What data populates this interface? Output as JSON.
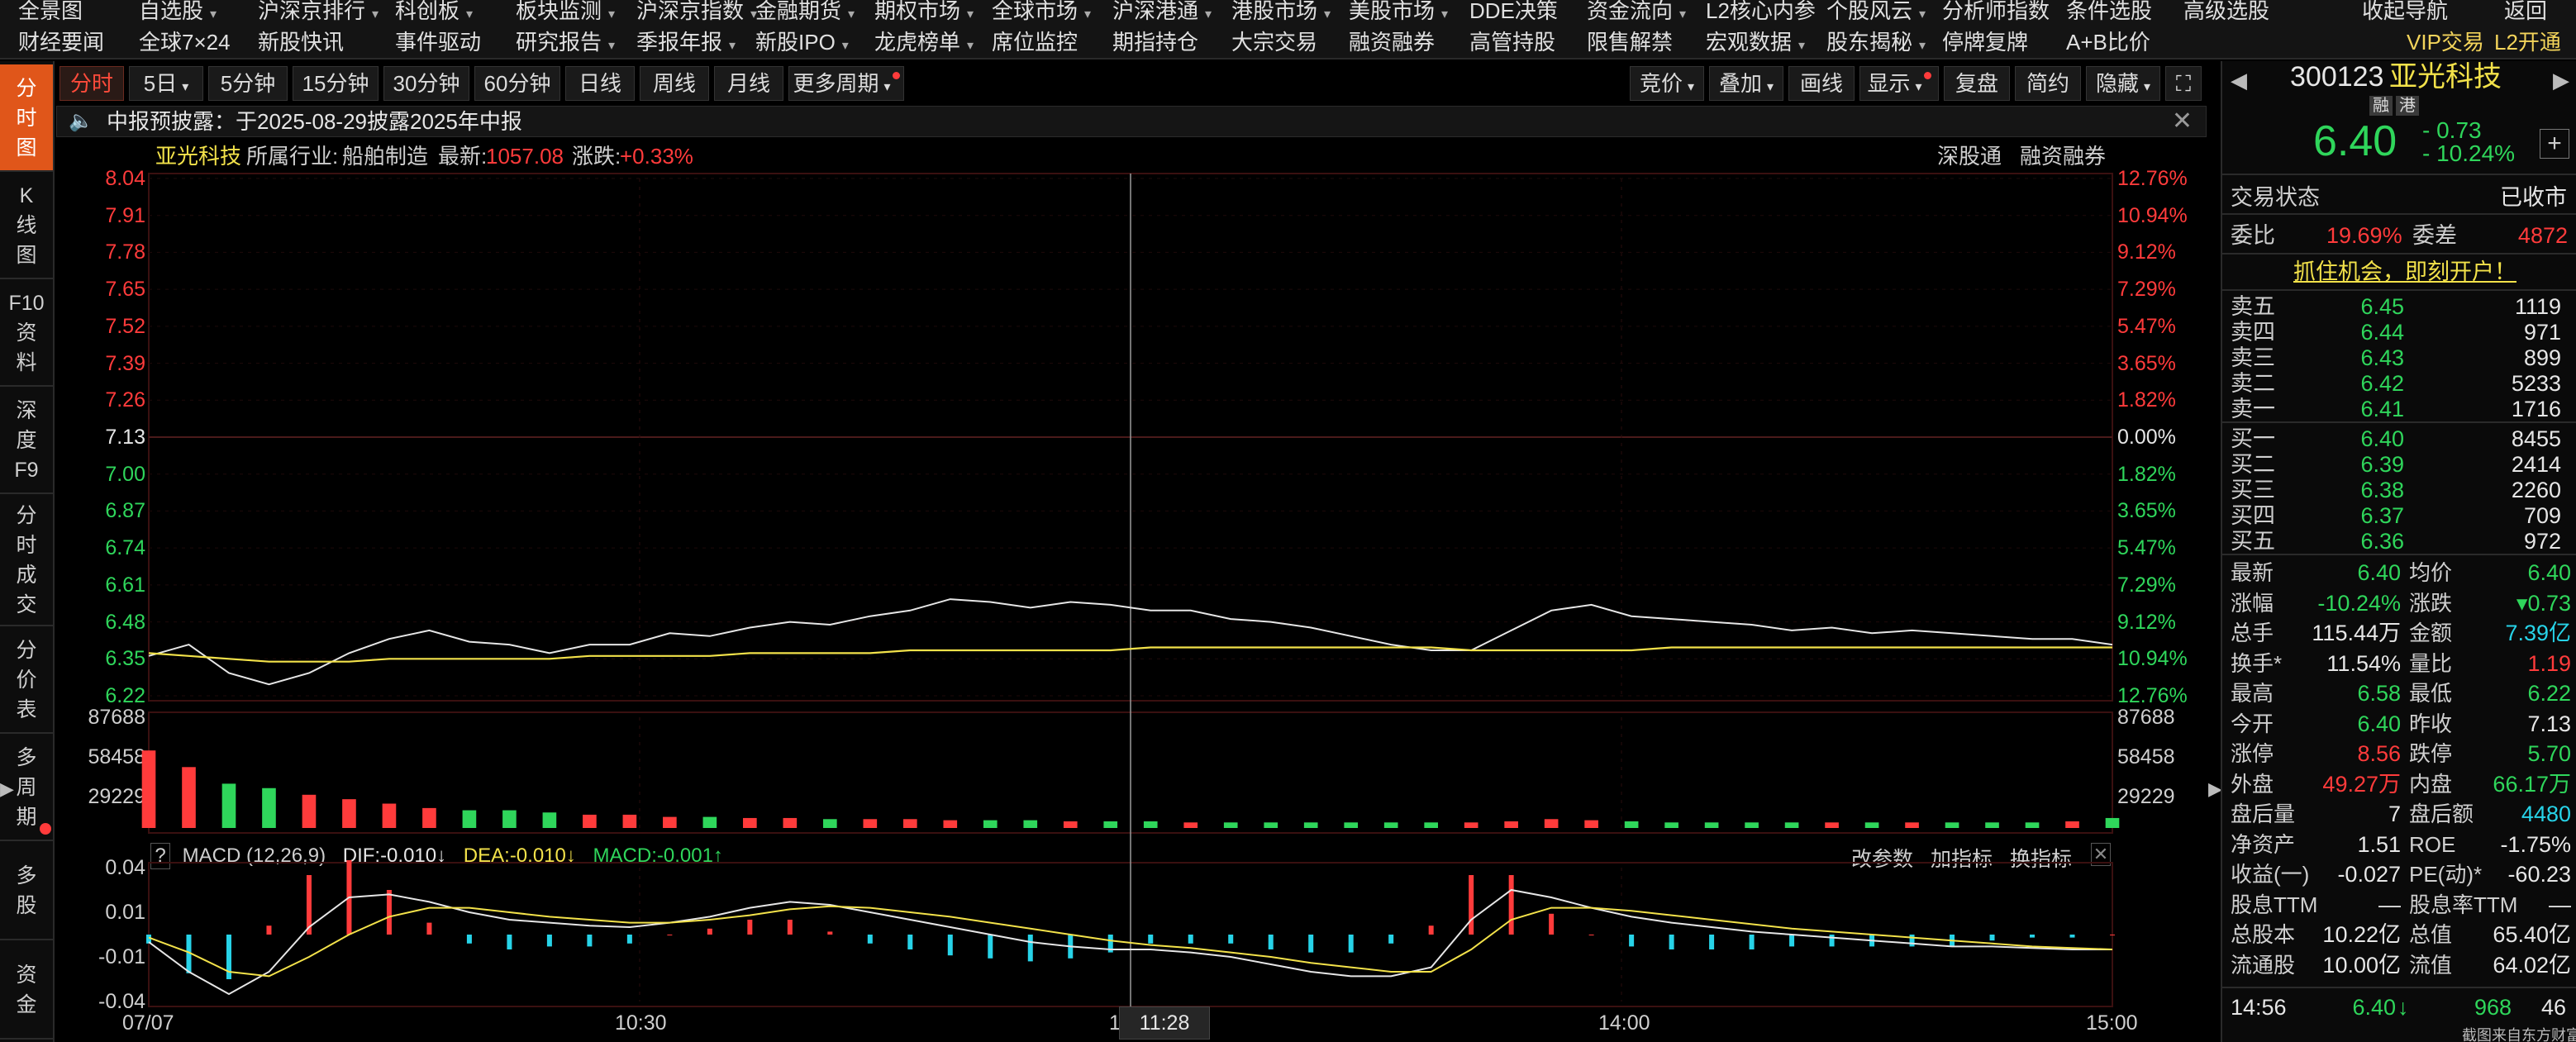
{
  "top_menu_row1": [
    {
      "label": "全景图",
      "x": 22,
      "caret": false
    },
    {
      "label": "自选股",
      "x": 168,
      "caret": true
    },
    {
      "label": "沪深京排行",
      "x": 312,
      "caret": true
    },
    {
      "label": "科创板",
      "x": 478,
      "caret": true
    },
    {
      "label": "板块监测",
      "x": 624,
      "caret": true
    },
    {
      "label": "沪深京指数",
      "x": 770,
      "caret": true
    },
    {
      "label": "金融期货",
      "x": 914,
      "caret": true
    },
    {
      "label": "期权市场",
      "x": 1058,
      "caret": true
    },
    {
      "label": "全球市场",
      "x": 1200,
      "caret": true
    },
    {
      "label": "沪深港通",
      "x": 1346,
      "caret": true
    },
    {
      "label": "港股市场",
      "x": 1490,
      "caret": true
    },
    {
      "label": "美股市场",
      "x": 1632,
      "caret": true
    },
    {
      "label": "DDE决策",
      "x": 1778,
      "caret": false
    },
    {
      "label": "资金流向",
      "x": 1920,
      "caret": true
    },
    {
      "label": "L2核心内参",
      "x": 2064,
      "caret": false
    },
    {
      "label": "个股风云",
      "x": 2210,
      "caret": true
    },
    {
      "label": "分析师指数",
      "x": 2350,
      "caret": false
    },
    {
      "label": "条件选股",
      "x": 2500,
      "caret": false
    },
    {
      "label": "高级选股",
      "x": 2642,
      "caret": false
    },
    {
      "label": "收起导航",
      "x": 2858,
      "caret": false
    },
    {
      "label": "返回",
      "x": 3030,
      "caret": false
    }
  ],
  "top_menu_row2": [
    {
      "label": "财经要闻",
      "x": 22
    },
    {
      "label": "全球7×24",
      "x": 168
    },
    {
      "label": "新股快讯",
      "x": 312
    },
    {
      "label": "事件驱动",
      "x": 478
    },
    {
      "label": "研究报告",
      "x": 624,
      "caret": true
    },
    {
      "label": "季报年报",
      "x": 770,
      "caret": true
    },
    {
      "label": "新股IPO",
      "x": 914,
      "caret": true
    },
    {
      "label": "龙虎榜单",
      "x": 1058,
      "caret": true
    },
    {
      "label": "席位监控",
      "x": 1200
    },
    {
      "label": "期指持仓",
      "x": 1346
    },
    {
      "label": "大宗交易",
      "x": 1490
    },
    {
      "label": "融资融券",
      "x": 1632
    },
    {
      "label": "高管持股",
      "x": 1778
    },
    {
      "label": "限售解禁",
      "x": 1920
    },
    {
      "label": "宏观数据",
      "x": 2064,
      "caret": true
    },
    {
      "label": "股东揭秘",
      "x": 2210,
      "caret": true
    },
    {
      "label": "停牌复牌",
      "x": 2350
    },
    {
      "label": "A+B比价",
      "x": 2500
    },
    {
      "label": "VIP交易",
      "x": 2912,
      "vip": true
    },
    {
      "label": "L2开通",
      "x": 3018,
      "vip": true
    }
  ],
  "left_tabs": [
    {
      "chars": [
        "分",
        "时",
        "图"
      ],
      "top": 4,
      "h": 130,
      "active": true
    },
    {
      "chars": [
        "K",
        "线",
        "图"
      ],
      "top": 134,
      "h": 130
    },
    {
      "chars": [
        "F10",
        "资",
        "料"
      ],
      "top": 264,
      "h": 130
    },
    {
      "chars": [
        "深",
        "度",
        "F9"
      ],
      "top": 394,
      "h": 130
    },
    {
      "chars": [
        "分",
        "时",
        "成",
        "交"
      ],
      "top": 524,
      "h": 160
    },
    {
      "chars": [
        "分",
        "价",
        "表"
      ],
      "top": 684,
      "h": 130
    },
    {
      "chars": [
        "多",
        "周",
        "期"
      ],
      "top": 814,
      "h": 130
    },
    {
      "chars": [
        "多",
        "股"
      ],
      "top": 944,
      "h": 120
    },
    {
      "chars": [
        "资",
        "金"
      ],
      "top": 1064,
      "h": 120
    }
  ],
  "toolbar": {
    "left": [
      {
        "label": "分时",
        "w": 78,
        "active": true
      },
      {
        "label": "5日",
        "w": 90,
        "caret": true
      },
      {
        "label": "5分钟",
        "w": 96
      },
      {
        "label": "15分钟",
        "w": 104
      },
      {
        "label": "30分钟",
        "w": 104
      },
      {
        "label": "60分钟",
        "w": 104
      },
      {
        "label": "日线",
        "w": 84
      },
      {
        "label": "周线",
        "w": 84
      },
      {
        "label": "月线",
        "w": 84
      },
      {
        "label": "更多周期",
        "w": 140,
        "caret": true,
        "dot": true
      }
    ],
    "right": [
      {
        "label": "竞价",
        "w": 90,
        "caret": true
      },
      {
        "label": "叠加",
        "w": 90,
        "caret": true
      },
      {
        "label": "画线",
        "w": 80
      },
      {
        "label": "显示",
        "w": 96,
        "caret": true,
        "dot": true
      },
      {
        "label": "复盘",
        "w": 80
      },
      {
        "label": "简约",
        "w": 80
      },
      {
        "label": "隐藏",
        "w": 90,
        "caret": true
      },
      {
        "label": "⛶",
        "w": 44
      }
    ]
  },
  "notice": {
    "text": "中报预披露：于2025-08-29披露2025年中报"
  },
  "chart_header": {
    "name": "亚光科技",
    "industry_label": "所属行业:",
    "industry": "船舶制造",
    "latest_label": "最新:",
    "latest": "1057.08",
    "change_label": "涨跌:",
    "change": "+0.33%",
    "right_links": [
      "深股通",
      "融资融券"
    ]
  },
  "price_axis": {
    "left": [
      "8.04",
      "7.91",
      "7.78",
      "7.65",
      "7.52",
      "7.39",
      "7.26",
      "7.13",
      "7.00",
      "6.87",
      "6.74",
      "6.61",
      "6.48",
      "6.35",
      "6.22"
    ],
    "right": [
      "12.76%",
      "10.94%",
      "9.12%",
      "7.29%",
      "5.47%",
      "3.65%",
      "1.82%",
      "0.00%",
      "1.82%",
      "3.65%",
      "5.47%",
      "7.29%",
      "9.12%",
      "10.94%",
      "12.76%"
    ],
    "prev_close_index": 7
  },
  "volume_axis": {
    "labels": [
      "87688",
      "58458",
      "29229"
    ]
  },
  "macd": {
    "help": "?",
    "title": "MACD (12,26,9)",
    "dif": "DIF:-0.010↓",
    "dea": "DEA:-0.010↓",
    "macd": "MACD:-0.001↑",
    "actions": [
      "改参数",
      "加指标",
      "换指标"
    ],
    "axis": [
      "0.04",
      "0.01",
      "-0.01",
      "-0.04"
    ]
  },
  "time_axis": {
    "labels": [
      "07/07",
      "10:30",
      "11:28",
      "14:00",
      "15:00"
    ],
    "cursor_label": "11:28"
  },
  "chart_data": {
    "type": "line",
    "title": "",
    "xlabel": "",
    "ylabel": "",
    "ylim": [
      6.22,
      8.04
    ],
    "prev_close": 7.13,
    "x": [
      "09:30",
      "09:35",
      "09:40",
      "09:45",
      "09:50",
      "09:55",
      "10:00",
      "10:05",
      "10:10",
      "10:15",
      "10:20",
      "10:25",
      "10:30",
      "10:35",
      "10:40",
      "10:45",
      "10:50",
      "10:55",
      "11:00",
      "11:05",
      "11:10",
      "11:15",
      "11:20",
      "11:25",
      "11:30",
      "13:00",
      "13:05",
      "13:10",
      "13:15",
      "13:20",
      "13:25",
      "13:30",
      "13:35",
      "13:40",
      "13:45",
      "13:50",
      "13:55",
      "14:00",
      "14:05",
      "14:10",
      "14:15",
      "14:20",
      "14:25",
      "14:30",
      "14:35",
      "14:40",
      "14:45",
      "14:50",
      "14:55",
      "15:00"
    ],
    "series": [
      {
        "name": "",
        "color": "#e6e6e6",
        "values": [
          6.36,
          6.4,
          6.3,
          6.26,
          6.3,
          6.37,
          6.42,
          6.45,
          6.41,
          6.4,
          6.37,
          6.4,
          6.4,
          6.44,
          6.43,
          6.46,
          6.48,
          6.47,
          6.5,
          6.52,
          6.56,
          6.55,
          6.53,
          6.55,
          6.54,
          6.52,
          6.52,
          6.49,
          6.48,
          6.46,
          6.43,
          6.4,
          6.38,
          6.38,
          6.45,
          6.52,
          6.54,
          6.5,
          6.49,
          6.48,
          6.47,
          6.45,
          6.46,
          6.44,
          6.45,
          6.44,
          6.43,
          6.42,
          6.42,
          6.4
        ]
      },
      {
        "name": "",
        "color": "#f3e24a",
        "values": [
          6.37,
          6.36,
          6.35,
          6.34,
          6.34,
          6.34,
          6.35,
          6.35,
          6.35,
          6.35,
          6.35,
          6.36,
          6.36,
          6.36,
          6.36,
          6.37,
          6.37,
          6.37,
          6.37,
          6.38,
          6.38,
          6.38,
          6.38,
          6.38,
          6.38,
          6.39,
          6.39,
          6.39,
          6.39,
          6.39,
          6.39,
          6.39,
          6.39,
          6.38,
          6.38,
          6.38,
          6.38,
          6.38,
          6.39,
          6.39,
          6.39,
          6.39,
          6.39,
          6.39,
          6.39,
          6.39,
          6.39,
          6.39,
          6.39,
          6.39
        ]
      }
    ],
    "volume": [
      70,
      55,
      40,
      36,
      30,
      26,
      22,
      18,
      16,
      16,
      14,
      12,
      12,
      10,
      10,
      9,
      9,
      8,
      8,
      8,
      7,
      7,
      7,
      6,
      6,
      6,
      5,
      5,
      5,
      5,
      5,
      5,
      5,
      5,
      6,
      8,
      7,
      6,
      5,
      5,
      5,
      5,
      5,
      5,
      5,
      5,
      5,
      5,
      6,
      9
    ],
    "volume_ylim": [
      0,
      87688
    ],
    "macd_dif": [
      -0.005,
      -0.025,
      -0.04,
      -0.025,
      0.005,
      0.025,
      0.027,
      0.022,
      0.015,
      0.01,
      0.008,
      0.006,
      0.005,
      0.008,
      0.012,
      0.018,
      0.022,
      0.02,
      0.015,
      0.01,
      0.005,
      0.0,
      -0.005,
      -0.008,
      -0.01,
      -0.01,
      -0.012,
      -0.015,
      -0.02,
      -0.025,
      -0.028,
      -0.028,
      -0.022,
      0.01,
      0.03,
      0.025,
      0.018,
      0.012,
      0.008,
      0.005,
      0.002,
      0.0,
      -0.002,
      -0.004,
      -0.006,
      -0.008,
      -0.008,
      -0.009,
      -0.01,
      -0.01
    ],
    "macd_dea": [
      -0.002,
      -0.012,
      -0.025,
      -0.028,
      -0.015,
      0.0,
      0.012,
      0.018,
      0.018,
      0.015,
      0.012,
      0.01,
      0.008,
      0.008,
      0.01,
      0.013,
      0.017,
      0.019,
      0.018,
      0.015,
      0.012,
      0.008,
      0.004,
      0.0,
      -0.004,
      -0.007,
      -0.009,
      -0.012,
      -0.015,
      -0.019,
      -0.022,
      -0.025,
      -0.025,
      -0.01,
      0.01,
      0.018,
      0.018,
      0.016,
      0.013,
      0.01,
      0.007,
      0.004,
      0.002,
      0.0,
      -0.002,
      -0.004,
      -0.006,
      -0.008,
      -0.009,
      -0.01
    ],
    "macd_ylim": [
      -0.045,
      0.045
    ]
  },
  "right_panel": {
    "code": "300123",
    "name": "亚光科技",
    "tags": [
      "融",
      "港"
    ],
    "price": "6.40",
    "change": "- 0.73",
    "change_pct": "- 10.24%",
    "status_label": "交易状态",
    "status": "已收市",
    "weibi_label": "委比",
    "weibi": "19.69%",
    "weicha_label": "委差",
    "weicha": "4872",
    "promo": "抓住机会，即刻开户！",
    "asks": [
      {
        "label": "卖五",
        "price": "6.45",
        "vol": "1119"
      },
      {
        "label": "卖四",
        "price": "6.44",
        "vol": "971"
      },
      {
        "label": "卖三",
        "price": "6.43",
        "vol": "899"
      },
      {
        "label": "卖二",
        "price": "6.42",
        "vol": "5233"
      },
      {
        "label": "卖一",
        "price": "6.41",
        "vol": "1716"
      }
    ],
    "bids": [
      {
        "label": "买一",
        "price": "6.40",
        "vol": "8455"
      },
      {
        "label": "买二",
        "price": "6.39",
        "vol": "2414"
      },
      {
        "label": "买三",
        "price": "6.38",
        "vol": "2260"
      },
      {
        "label": "买四",
        "price": "6.37",
        "vol": "709"
      },
      {
        "label": "买五",
        "price": "6.36",
        "vol": "972"
      }
    ],
    "stats": [
      [
        {
          "l": "最新",
          "v": "6.40",
          "c": "c-green"
        },
        {
          "l": "均价",
          "v": "6.40",
          "c": "c-green"
        }
      ],
      [
        {
          "l": "涨幅",
          "v": "-10.24%",
          "c": "c-green"
        },
        {
          "l": "涨跌",
          "v": "▾0.73",
          "c": "c-green"
        }
      ],
      [
        {
          "l": "总手",
          "v": "115.44万",
          "c": "c-white"
        },
        {
          "l": "金额",
          "v": "7.39亿",
          "c": "cyan"
        }
      ],
      [
        {
          "l": "换手*",
          "v": "11.54%",
          "c": "c-white"
        },
        {
          "l": "量比",
          "v": "1.19",
          "c": "c-red"
        }
      ],
      [
        {
          "l": "最高",
          "v": "6.58",
          "c": "c-green"
        },
        {
          "l": "最低",
          "v": "6.22",
          "c": "c-green"
        }
      ],
      [
        {
          "l": "今开",
          "v": "6.40",
          "c": "c-green"
        },
        {
          "l": "昨收",
          "v": "7.13",
          "c": "c-white"
        }
      ],
      [
        {
          "l": "涨停",
          "v": "8.56",
          "c": "c-red"
        },
        {
          "l": "跌停",
          "v": "5.70",
          "c": "c-green"
        }
      ],
      [
        {
          "l": "外盘",
          "v": "49.27万",
          "c": "c-red"
        },
        {
          "l": "内盘",
          "v": "66.17万",
          "c": "c-green"
        }
      ],
      [
        {
          "l": "盘后量",
          "v": "7",
          "c": "c-white"
        },
        {
          "l": "盘后额",
          "v": "4480",
          "c": "cyan"
        }
      ],
      [
        {
          "l": "净资产",
          "v": "1.51",
          "c": "c-white"
        },
        {
          "l": "ROE",
          "v": "-1.75%",
          "c": "c-white"
        }
      ],
      [
        {
          "l": "收益(一)",
          "v": "-0.027",
          "c": "c-white"
        },
        {
          "l": "PE(动)*",
          "v": "-60.23",
          "c": "c-white"
        }
      ],
      [
        {
          "l": "股息TTM",
          "v": "—",
          "c": "c-white"
        },
        {
          "l": "股息率TTM",
          "v": "—",
          "c": "c-white"
        }
      ],
      [
        {
          "l": "总股本",
          "v": "10.22亿",
          "c": "c-white"
        },
        {
          "l": "总值",
          "v": "65.40亿",
          "c": "c-white"
        }
      ],
      [
        {
          "l": "流通股",
          "v": "10.00亿",
          "c": "c-white"
        },
        {
          "l": "流值",
          "v": "64.02亿",
          "c": "c-white"
        }
      ]
    ],
    "ticks": [
      {
        "time": "14:56",
        "price": "6.40",
        "arrow": "↓",
        "vol": "968",
        "n": "46"
      }
    ],
    "watermark": "截图来自东方财富"
  }
}
